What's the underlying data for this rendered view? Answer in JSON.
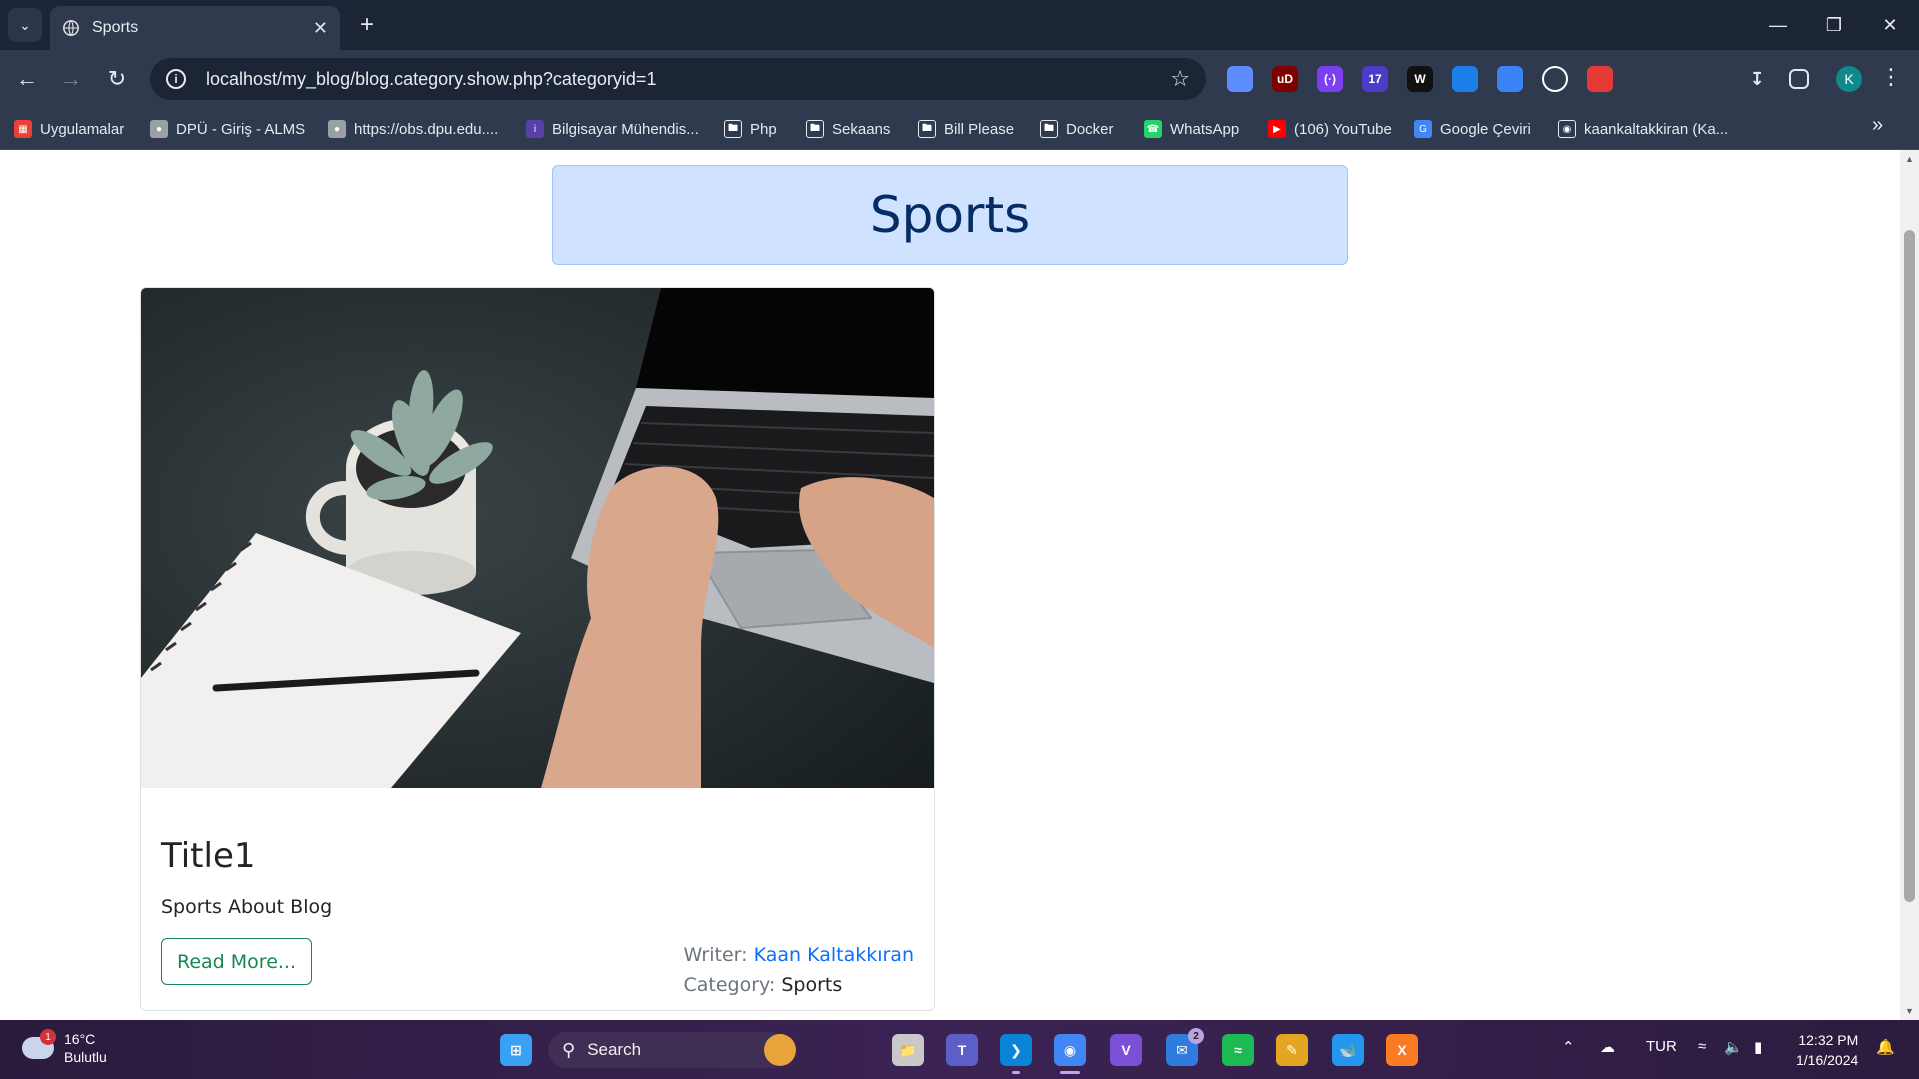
{
  "browser": {
    "tab_title": "Sports",
    "url": "localhost/my_blog/blog.category.show.php?categoryid=1",
    "profile_initial": "K",
    "extensions": [
      {
        "name": "pen-tool-icon",
        "label": "",
        "color": "#5c8cff"
      },
      {
        "name": "ublock-icon",
        "label": "uD",
        "color": "#800000"
      },
      {
        "name": "sound-icon",
        "label": "(·)",
        "color": "#7b3ff2"
      },
      {
        "name": "extension-badge-icon",
        "label": "17",
        "color": "#4b3cc9"
      },
      {
        "name": "w-extension-icon",
        "label": "W",
        "color": "#111111"
      },
      {
        "name": "edge-like-icon",
        "label": "",
        "color": "#1c7ee8"
      },
      {
        "name": "file-icon",
        "label": "",
        "color": "#3b82f6"
      },
      {
        "name": "circle-extension-icon",
        "label": "",
        "color": "#ffffff"
      },
      {
        "name": "record-icon",
        "label": "",
        "color": "#e53935"
      },
      {
        "name": "eyedropper-icon",
        "label": "",
        "color": "#e6e9ef"
      },
      {
        "name": "puzzle-icon",
        "label": "",
        "color": "#e6e9ef"
      }
    ]
  },
  "bookmarks": [
    {
      "label": "Uygulamalar",
      "icon": "apps-grid-icon",
      "color": "#e94235"
    },
    {
      "label": "DPÜ - Giriş - ALMS",
      "icon": "globe-icon",
      "color": "#9aa0a6"
    },
    {
      "label": "https://obs.dpu.edu....",
      "icon": "globe-icon",
      "color": "#9aa0a6"
    },
    {
      "label": "Bilgisayar Mühendis...",
      "icon": "info-site-icon",
      "color": "#5b3fa8"
    },
    {
      "label": "Php",
      "icon": "folder-icon",
      "color": "#2f3a4e"
    },
    {
      "label": "Sekaans",
      "icon": "folder-icon",
      "color": "#2f3a4e"
    },
    {
      "label": "Bill Please",
      "icon": "folder-icon",
      "color": "#2f3a4e"
    },
    {
      "label": "Docker",
      "icon": "folder-icon",
      "color": "#2f3a4e"
    },
    {
      "label": "WhatsApp",
      "icon": "whatsapp-icon",
      "color": "#25d366"
    },
    {
      "label": "(106) YouTube",
      "icon": "youtube-icon",
      "color": "#ff0000"
    },
    {
      "label": "Google Çeviri",
      "icon": "google-translate-icon",
      "color": "#4285f4"
    },
    {
      "label": "kaankaltakkiran (Ka...",
      "icon": "github-icon",
      "color": "#2f3a4e"
    }
  ],
  "page": {
    "category_heading": "Sports",
    "post": {
      "title": "Title1",
      "summary": "Sports About Blog",
      "read_more_label": "Read More...",
      "writer_label": "Writer:",
      "writer_name": "Kaan Kaltakkıran",
      "category_label": "Category:",
      "category_name": "Sports"
    }
  },
  "taskbar": {
    "weather_temp": "16°C",
    "weather_desc": "Bulutlu",
    "weather_badge": "1",
    "search_placeholder": "Search",
    "language": "TUR",
    "time": "12:32 PM",
    "date": "1/16/2024",
    "mail_badge": "2",
    "apps": [
      {
        "name": "start-icon",
        "color": "#3aa0f3"
      },
      {
        "name": "copilot-icon",
        "color": "#e8a33a"
      },
      {
        "name": "file-explorer-icon",
        "color": "#c8c8c8"
      },
      {
        "name": "teams-icon",
        "color": "#5b5fc7"
      },
      {
        "name": "vscode-icon",
        "color": "#0a84d6"
      },
      {
        "name": "chrome-icon",
        "color": "#4285f4"
      },
      {
        "name": "visual-studio-icon",
        "color": "#7b4fd6"
      },
      {
        "name": "mail-icon",
        "color": "#2f7bde"
      },
      {
        "name": "spotify-icon",
        "color": "#1db954"
      },
      {
        "name": "sticky-notes-icon",
        "color": "#e2a623"
      },
      {
        "name": "docker-icon",
        "color": "#2496ed"
      },
      {
        "name": "xampp-icon",
        "color": "#fb7a24"
      }
    ]
  }
}
